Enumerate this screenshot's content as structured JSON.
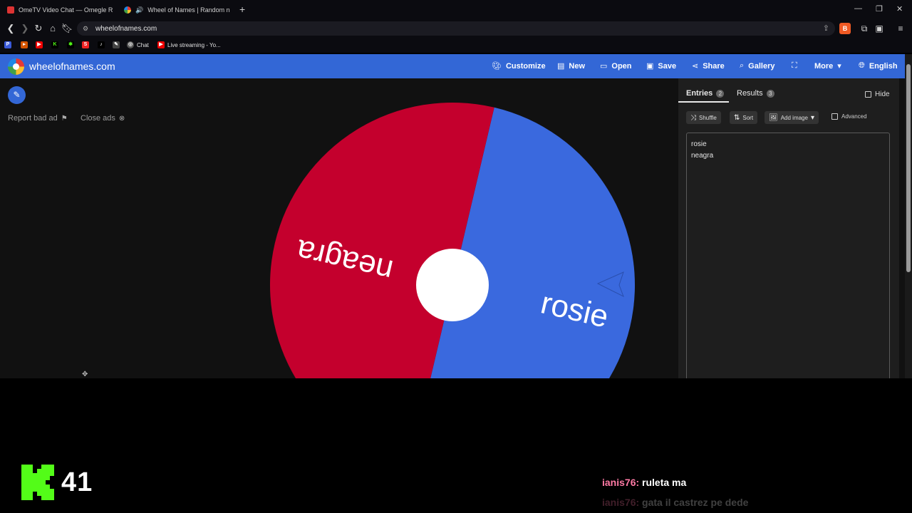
{
  "browser": {
    "tabs": [
      {
        "title": "OmeTV Video Chat — Omegle R",
        "active": false
      },
      {
        "title": "Wheel of Names | Random n",
        "active": true
      }
    ],
    "new_tab_icon": "plus-icon",
    "url": "wheelofnames.com",
    "bookmarks": [
      {
        "label": "",
        "icon": "pl-icon"
      },
      {
        "label": "",
        "icon": "flag-icon"
      },
      {
        "label": "",
        "icon": "youtube-icon"
      },
      {
        "label": "",
        "icon": "kick-icon"
      },
      {
        "label": "",
        "icon": "puzzle-icon"
      },
      {
        "label": "",
        "icon": "s-icon"
      },
      {
        "label": "",
        "icon": "tiktok-icon"
      },
      {
        "label": "",
        "icon": "pen-icon"
      },
      {
        "label": "Chat",
        "icon": "chat-icon"
      },
      {
        "label": "Live streaming - Yo...",
        "icon": "youtube-icon"
      }
    ]
  },
  "site": {
    "name": "wheelofnames.com",
    "nav": {
      "customize": "Customize",
      "new": "New",
      "open": "Open",
      "save": "Save",
      "share": "Share",
      "gallery": "Gallery",
      "more": "More",
      "language": "English"
    },
    "ads": {
      "report": "Report bad ad",
      "close": "Close ads"
    }
  },
  "wheel": {
    "segments": [
      {
        "label": "rosie",
        "color": "#3a69de"
      },
      {
        "label": "neagra",
        "color": "#c4002d"
      }
    ]
  },
  "panel": {
    "tabs": [
      {
        "label": "Entries",
        "count": "2"
      },
      {
        "label": "Results",
        "count": "3"
      }
    ],
    "hide_label": "Hide",
    "buttons": {
      "shuffle": "Shuffle",
      "sort": "Sort",
      "add_image": "Add image"
    },
    "advanced_label": "Advanced",
    "entries": [
      "rosie",
      "neagra"
    ]
  },
  "stream": {
    "viewer_count": "41",
    "chat": [
      {
        "user": "ianis76:",
        "message": "ruleta ma"
      },
      {
        "user": "ianis76:",
        "message": "gata il castrez pe dede"
      }
    ]
  },
  "colors": {
    "site_header": "#3367d6",
    "kick_green": "#53fc18",
    "chat_user": "#ff7aa5"
  }
}
